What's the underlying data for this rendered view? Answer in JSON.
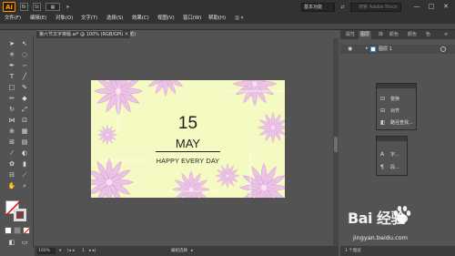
{
  "app": {
    "logo_text": "Ai",
    "bridge_icons": [
      "Br",
      "St"
    ],
    "workspace": "基本功能",
    "search_placeholder": "搜索 Adobe Stock",
    "window_controls": [
      "—",
      "□",
      "✕"
    ]
  },
  "menu": {
    "items": [
      "文件(F)",
      "编辑(E)",
      "对象(O)",
      "文字(T)",
      "选择(S)",
      "效果(C)",
      "视图(V)",
      "窗口(W)",
      "帮助(H)"
    ]
  },
  "document": {
    "tab_title": "第六节文字排版.ai* @ 100% (RGB/GPU 预览)",
    "close": "×"
  },
  "artboard": {
    "background": "#f5fac3",
    "number": "15",
    "month": "MAY",
    "subtitle": "HAPPY  EVERY  DAY",
    "flower_color": "#e8b8e0"
  },
  "status": {
    "zoom": "100%",
    "page": "1",
    "tool": "编组选择"
  },
  "right_panel": {
    "tabs": [
      "属性",
      "图层",
      "库",
      "颜色",
      "颜色",
      "色"
    ],
    "active_tab_index": 1,
    "layer": {
      "name": "图层 1"
    },
    "footer": "1 个图层"
  },
  "float_panel_a": {
    "items": [
      {
        "icon": "transform-icon",
        "label": "变换"
      },
      {
        "icon": "align-icon",
        "label": "对齐"
      },
      {
        "icon": "pathfinder-icon",
        "label": "路径查找..."
      }
    ]
  },
  "float_panel_b": {
    "items": [
      {
        "icon": "character-icon",
        "label": "字..."
      },
      {
        "icon": "paragraph-icon",
        "label": "段..."
      }
    ]
  },
  "watermark": {
    "brand": "Bai  经验",
    "url": "jingyan.baidu.com"
  },
  "colors": {
    "accent_ai": "#ff9a00",
    "ui_dark": "#323232",
    "ui_mid": "#535353"
  }
}
